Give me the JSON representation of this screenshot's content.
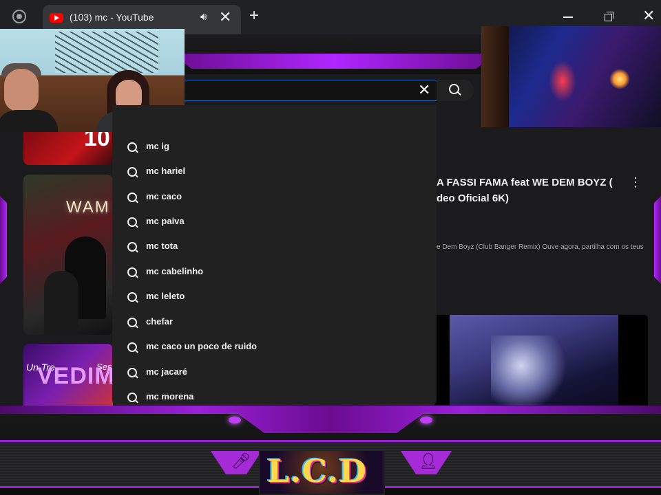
{
  "browser": {
    "tab_title": "(103) mc - YouTube",
    "tab_audio_icon": "speaker-icon",
    "close_glyph": "✕",
    "new_tab_glyph": "+",
    "window_close_glyph": "✕"
  },
  "search": {
    "clear_glyph": "✕",
    "suggestions": [
      "mc ig",
      "mc hariel",
      "mc caco",
      "mc paiva",
      "mc tota",
      "mc cabelinho",
      "mc leleto",
      "chefar",
      "mc caco un poco de ruido",
      "mc jacaré",
      "mc morena"
    ]
  },
  "results": {
    "video_title_line1": "A FASSI FAMA feat WE DEM BOYZ (",
    "video_title_line2": "deo Oficial 6K)",
    "video_menu_glyph": "⋮",
    "video_description": "e Dem Boyz (Club Banger Remix) Ouve agora, partilha com os teus",
    "thumb1_text": "10",
    "thumb2_text": "WAM",
    "thumb3_text": "VEDIM",
    "thumb3_script_left": "Un Tre",
    "thumb3_script_right": "Ses"
  },
  "overlay": {
    "logo_text": "L.C.D",
    "accent_color": "#b026ff"
  }
}
